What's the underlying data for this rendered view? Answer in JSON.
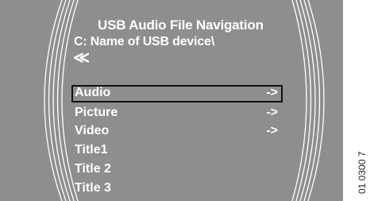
{
  "screen": {
    "title": "USB Audio File Navigation",
    "path": "C: Name of USB device\\",
    "back_label": "≪"
  },
  "menu": {
    "items": [
      {
        "label": "Audio",
        "arrow": "->",
        "selected": true
      },
      {
        "label": "Picture",
        "arrow": "->"
      },
      {
        "label": "Video",
        "arrow": "->"
      },
      {
        "label": "Title1"
      },
      {
        "label": "Title 2"
      },
      {
        "label": "Title 3"
      }
    ]
  },
  "figure_code": "01 0300 7",
  "colors": {
    "screen_bg": "#8e8e8e",
    "text": "#ffffff",
    "selection_border": "#111111"
  }
}
